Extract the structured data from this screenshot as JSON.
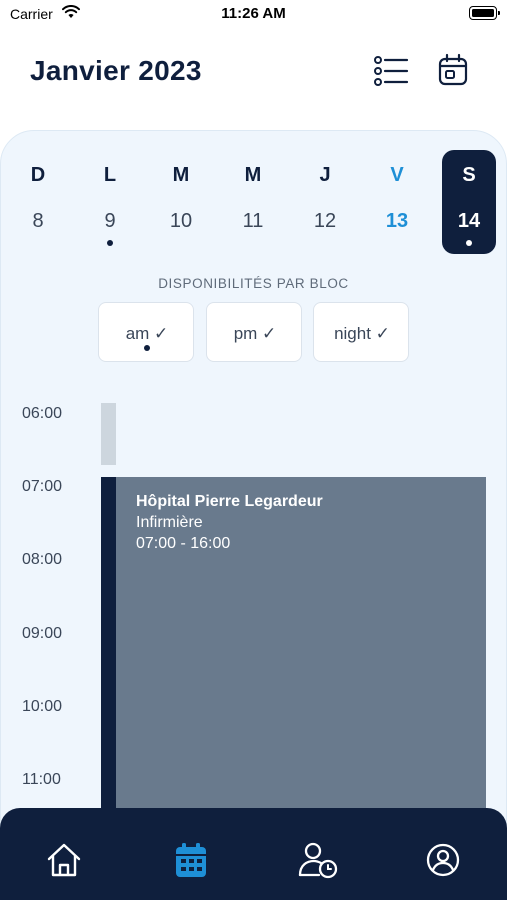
{
  "status_bar": {
    "carrier": "Carrier",
    "time": "11:26 AM"
  },
  "header": {
    "title": "Janvier 2023",
    "icons": [
      "list-view-icon",
      "calendar-view-icon"
    ]
  },
  "week": {
    "days": [
      {
        "letter": "D",
        "number": "8",
        "has_event": false,
        "state": "normal"
      },
      {
        "letter": "L",
        "number": "9",
        "has_event": true,
        "state": "normal"
      },
      {
        "letter": "M",
        "number": "10",
        "has_event": false,
        "state": "normal"
      },
      {
        "letter": "M",
        "number": "11",
        "has_event": false,
        "state": "normal"
      },
      {
        "letter": "J",
        "number": "12",
        "has_event": false,
        "state": "normal"
      },
      {
        "letter": "V",
        "number": "13",
        "has_event": false,
        "state": "today"
      },
      {
        "letter": "S",
        "number": "14",
        "has_event": true,
        "state": "selected"
      }
    ]
  },
  "availability": {
    "label": "DISPONIBILITÉS PAR BLOC",
    "blocks": [
      {
        "label": "am ✓",
        "has_dot": true
      },
      {
        "label": "pm ✓",
        "has_dot": false
      },
      {
        "label": "night ✓",
        "has_dot": false
      }
    ]
  },
  "timeline": {
    "hours": [
      "06:00",
      "07:00",
      "08:00",
      "09:00",
      "10:00",
      "11:00"
    ],
    "event": {
      "title": "Hôpital Pierre Legardeur",
      "role": "Infirmière",
      "time": "07:00 - 16:00"
    }
  },
  "tabbar": {
    "items": [
      {
        "icon": "home-icon",
        "active": false
      },
      {
        "icon": "calendar-icon",
        "active": true
      },
      {
        "icon": "user-schedule-icon",
        "active": false
      },
      {
        "icon": "profile-icon",
        "active": false
      }
    ]
  },
  "colors": {
    "navy": "#0f1f3d",
    "accent_blue": "#1e8fd6",
    "panel_bg": "#eff6fd",
    "event_bg": "#697a8d",
    "availability_bar": "#cdd6de"
  }
}
